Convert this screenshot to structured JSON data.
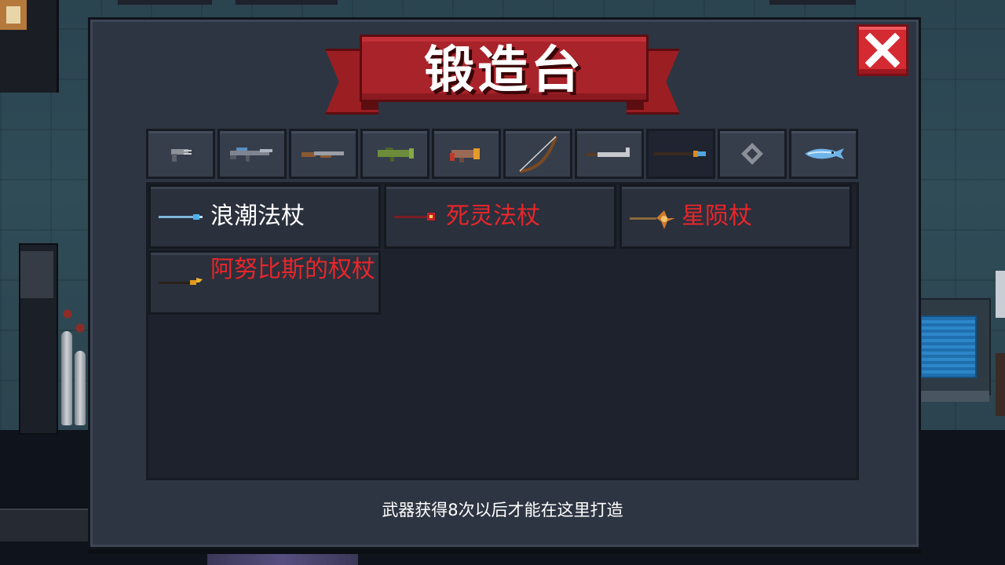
{
  "title": "锻造台",
  "icons": {
    "close": "close-x-icon"
  },
  "tabs": [
    {
      "icon": "pistol-icon",
      "active": false
    },
    {
      "icon": "rifle-icon",
      "active": false
    },
    {
      "icon": "shotgun-icon",
      "active": false
    },
    {
      "icon": "rocket-launcher-icon",
      "active": false
    },
    {
      "icon": "blaster-icon",
      "active": false
    },
    {
      "icon": "bow-icon",
      "active": false
    },
    {
      "icon": "sword-icon",
      "active": false
    },
    {
      "icon": "staff-icon",
      "active": true
    },
    {
      "icon": "shuriken-icon",
      "active": false
    },
    {
      "icon": "fish-icon",
      "active": false
    }
  ],
  "weapons": [
    {
      "name": "浪潮法杖",
      "color": "#ffffff",
      "icon": "tide-staff-icon"
    },
    {
      "name": "死灵法杖",
      "color": "#e8262b",
      "icon": "necro-staff-icon"
    },
    {
      "name": "星陨杖",
      "color": "#e8262b",
      "icon": "meteor-staff-icon"
    },
    {
      "name": "阿努比斯的权杖",
      "color": "#e8262b",
      "icon": "anubis-scepter-icon"
    }
  ],
  "hint": "武器获得8次以后才能在这里打造",
  "colors": {
    "banner": "#a9232a",
    "close": "#d42b33",
    "locked_text": "#e8262b",
    "unlocked_text": "#ffffff"
  }
}
